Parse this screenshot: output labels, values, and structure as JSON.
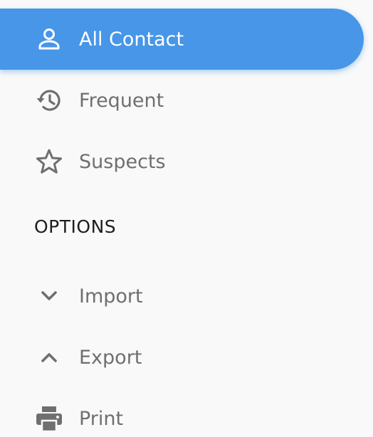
{
  "menu": {
    "items": [
      {
        "label": "All Contact",
        "icon": "person-icon",
        "active": true
      },
      {
        "label": "Frequent",
        "icon": "history-icon",
        "active": false
      },
      {
        "label": "Suspects",
        "icon": "star-outline-icon",
        "active": false
      }
    ]
  },
  "options": {
    "header": "OPTIONS",
    "items": [
      {
        "label": "Import",
        "icon": "chevron-down-icon"
      },
      {
        "label": "Export",
        "icon": "chevron-up-icon"
      },
      {
        "label": "Print",
        "icon": "printer-icon"
      }
    ]
  },
  "colors": {
    "accent": "#4796e8",
    "icon_gray": "#6f6f6f",
    "background": "#f9f9f9",
    "header_text": "#1e1e1e"
  }
}
